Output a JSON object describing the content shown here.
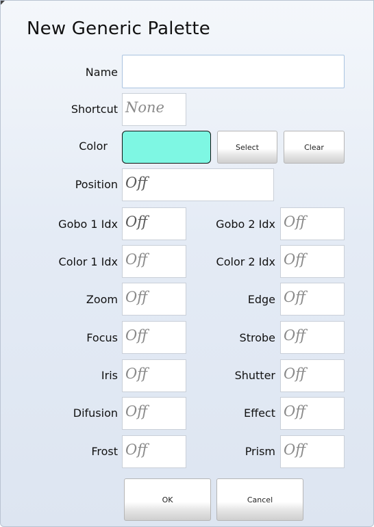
{
  "dialog": {
    "title": "New Generic Palette",
    "name_label": "Name",
    "name_value": "",
    "shortcut_label": "Shortcut",
    "shortcut_value": "None",
    "color_label": "Color",
    "color_value": "#7ef7e3",
    "select_label": "Select",
    "clear_label": "Clear",
    "position_label": "Position",
    "position_value": "Off",
    "fields_left": [
      {
        "label": "Gobo 1 Idx",
        "value": "Off"
      },
      {
        "label": "Color 1 Idx",
        "value": "Off"
      },
      {
        "label": "Zoom",
        "value": "Off"
      },
      {
        "label": "Focus",
        "value": "Off"
      },
      {
        "label": "Iris",
        "value": "Off"
      },
      {
        "label": "Difusion",
        "value": "Off"
      },
      {
        "label": "Frost",
        "value": "Off"
      }
    ],
    "fields_right": [
      {
        "label": "Gobo 2 Idx",
        "value": "Off"
      },
      {
        "label": "Color 2 Idx",
        "value": "Off"
      },
      {
        "label": "Edge",
        "value": "Off"
      },
      {
        "label": "Strobe",
        "value": "Off"
      },
      {
        "label": "Shutter",
        "value": "Off"
      },
      {
        "label": "Effect",
        "value": "Off"
      },
      {
        "label": "Prism",
        "value": "Off"
      }
    ],
    "ok_label": "OK",
    "cancel_label": "Cancel"
  }
}
